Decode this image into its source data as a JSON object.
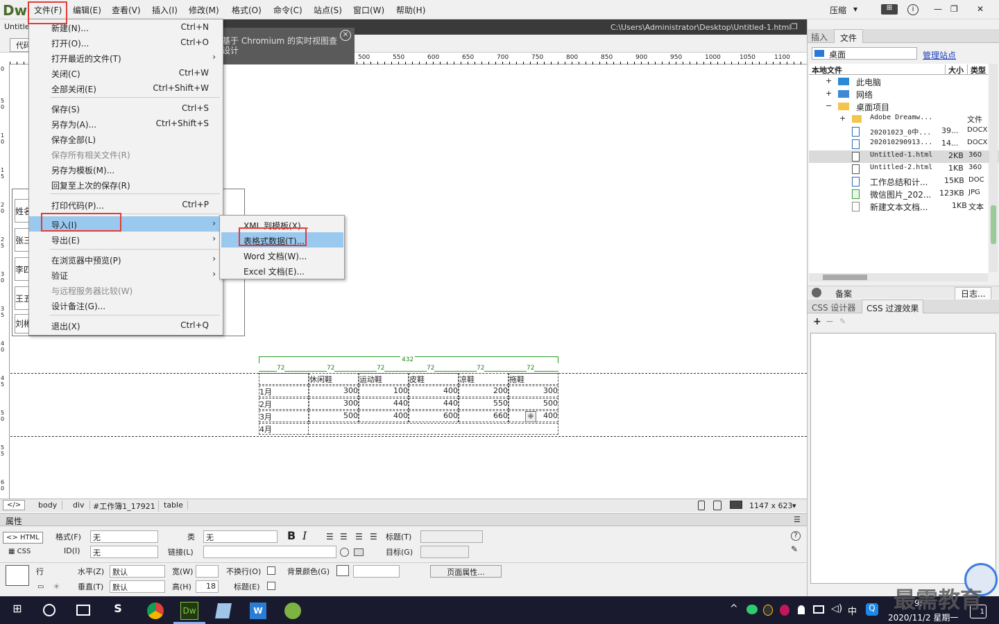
{
  "app": {
    "logo": "Dw",
    "compress_label": "压缩",
    "compress_arrow": "▾",
    "extract_icon": "⊞"
  },
  "menubar": [
    "文件(F)",
    "编辑(E)",
    "查看(V)",
    "插入(I)",
    "修改(M)",
    "格式(O)",
    "命令(C)",
    "站点(S)",
    "窗口(W)",
    "帮助(H)"
  ],
  "window": {
    "minimize": "—",
    "restore": "❐",
    "close": "✕"
  },
  "document": {
    "tab": "Untitle",
    "path": "C:\\Users\\Administrator\\Desktop\\Untitled-1.html",
    "view_button": "代码",
    "notice": "基于 Chromium 的实时视图查",
    "notice2": "设计",
    "notice_close": "✕"
  },
  "ruler": [
    "500",
    "550",
    "600",
    "650",
    "700",
    "750",
    "800",
    "850",
    "900",
    "950",
    "1000",
    "1050",
    "1100"
  ],
  "vruler": [
    "0",
    "5 0",
    "1 0",
    "1 5",
    "2 0",
    "2 5",
    "3 0",
    "3 5",
    "4 0",
    "4 5",
    "5 0",
    "5 5",
    "6 0"
  ],
  "file_menu": {
    "items": [
      {
        "label": "新建(N)...",
        "shortcut": "Ctrl+N"
      },
      {
        "label": "打开(O)...",
        "shortcut": "Ctrl+O"
      },
      {
        "label": "打开最近的文件(T)",
        "shortcut": "",
        "sub": true
      },
      {
        "label": "关闭(C)",
        "shortcut": "Ctrl+W"
      },
      {
        "label": "全部关闭(E)",
        "shortcut": "Ctrl+Shift+W"
      },
      {
        "label": "保存(S)",
        "shortcut": "Ctrl+S"
      },
      {
        "label": "另存为(A)...",
        "shortcut": "Ctrl+Shift+S"
      },
      {
        "label": "保存全部(L)",
        "shortcut": ""
      },
      {
        "label": "保存所有相关文件(R)",
        "shortcut": "",
        "disabled": true
      },
      {
        "label": "另存为模板(M)...",
        "shortcut": ""
      },
      {
        "label": "回复至上次的保存(R)",
        "shortcut": ""
      },
      {
        "label": "打印代码(P)...",
        "shortcut": "Ctrl+P"
      },
      {
        "label": "导入(I)",
        "shortcut": "",
        "sub": true,
        "selected": true
      },
      {
        "label": "导出(E)",
        "shortcut": "",
        "sub": true
      },
      {
        "label": "在浏览器中预览(P)",
        "shortcut": "",
        "sub": true
      },
      {
        "label": "验证",
        "shortcut": "",
        "sub": true
      },
      {
        "label": "与远程服务器比较(W)",
        "shortcut": "",
        "disabled": true
      },
      {
        "label": "设计备注(G)...",
        "shortcut": ""
      },
      {
        "label": "退出(X)",
        "shortcut": "Ctrl+Q"
      }
    ],
    "submenu_arrow": "›"
  },
  "import_submenu": {
    "items": [
      "XML 到模板(X)...",
      "表格式数据(T)...",
      "Word 文档(W)...",
      "Excel 文档(E)..."
    ]
  },
  "left_table": [
    "姓名",
    "张三",
    "李四",
    "王五",
    "刘彬"
  ],
  "design_table": {
    "total_width": "432",
    "col_width": "72",
    "col_widths": [
      "72",
      "72",
      "72",
      "72",
      "72",
      "72"
    ],
    "header": [
      "",
      "休闲鞋",
      "运动鞋",
      "皮鞋",
      "凉鞋",
      "拖鞋"
    ],
    "rows": [
      [
        "1月",
        "300",
        "100",
        "400",
        "200",
        "300"
      ],
      [
        "2月",
        "300",
        "440",
        "440",
        "550",
        "500"
      ],
      [
        "3月",
        "500",
        "400",
        "600",
        "660",
        "400"
      ],
      [
        "4月",
        "",
        "",
        "",
        "",
        ""
      ]
    ],
    "cell_marker": "⁜"
  },
  "tagbar": {
    "code_icon": "</>",
    "tags": [
      "body",
      "div",
      "#工作簿1_17921",
      "table"
    ],
    "size": "1147 x 623",
    "size_arrow": "▾"
  },
  "properties": {
    "title": "属性",
    "menu_icon": "☰",
    "html_label": "HTML",
    "css_label": "CSS",
    "format_label": "格式(F)",
    "format_value": "无",
    "id_label": "ID(I)",
    "id_value": "无",
    "class_label": "类",
    "class_value": "无",
    "link_label": "链接(L)",
    "link_value": "",
    "bold": "B",
    "italic": "I",
    "title_label": "标题(T)",
    "title_value": "",
    "target_label": "目标(G)",
    "target_value": "",
    "row_label": "行",
    "h_label": "水平(Z)",
    "h_value": "默认",
    "v_label": "垂直(T)",
    "v_value": "默认",
    "width_label": "宽(W)",
    "width_value": "",
    "height_label": "高(H)",
    "height_value": "18",
    "nowrap_label": "不换行(O)",
    "header_label": "标题(E)",
    "bg_label": "背景颜色(G)",
    "bg_value": "",
    "page_props": "页面属性...",
    "help_icon": "?",
    "dropdown": "▾"
  },
  "right_panel": {
    "tabs": [
      "插入",
      "文件"
    ],
    "site_select": "桌面",
    "manage_sites": "管理站点",
    "columns": [
      "本地文件",
      "大小",
      "类型"
    ],
    "tree": [
      {
        "name": "此电脑",
        "size": "",
        "type": "",
        "level": 1,
        "expand": "+"
      },
      {
        "name": "网络",
        "size": "",
        "type": "",
        "level": 1,
        "expand": "+"
      },
      {
        "name": "桌面项目",
        "size": "",
        "type": "",
        "level": 1,
        "expand": "−"
      },
      {
        "name": "Adobe Dreamw...",
        "size": "",
        "type": "文件",
        "level": 2,
        "expand": "+"
      },
      {
        "name": "20201023_0中...",
        "size": "39...",
        "type": "DOCX",
        "level": 2,
        "expand": ""
      },
      {
        "name": "20201029091З...",
        "size": "14...",
        "type": "DOCX",
        "level": 2,
        "expand": ""
      },
      {
        "name": "Untitled-1.html",
        "size": "2KB",
        "type": "360",
        "level": 2,
        "expand": "",
        "selected": true
      },
      {
        "name": "Untitled-2.html",
        "size": "1KB",
        "type": "360",
        "level": 2,
        "expand": ""
      },
      {
        "name": "工作总结和计...",
        "size": "15KB",
        "type": "DOC",
        "level": 2,
        "expand": ""
      },
      {
        "name": "微信图片_202...",
        "size": "123KB",
        "type": "JPG",
        "level": 2,
        "expand": ""
      },
      {
        "name": "新建文本文档...",
        "size": "1KB",
        "type": "文本",
        "level": 2,
        "expand": ""
      }
    ],
    "backup_label": "备案",
    "log_label": "日志...",
    "css_tabs": [
      "CSS 设计器",
      "CSS 过渡效果"
    ],
    "css_add": "+",
    "css_remove": "−"
  },
  "taskbar": {
    "time": "9:",
    "date": "2020/11/2 星期一",
    "ime": "中",
    "badge": "1",
    "watermark": "最需教育"
  }
}
